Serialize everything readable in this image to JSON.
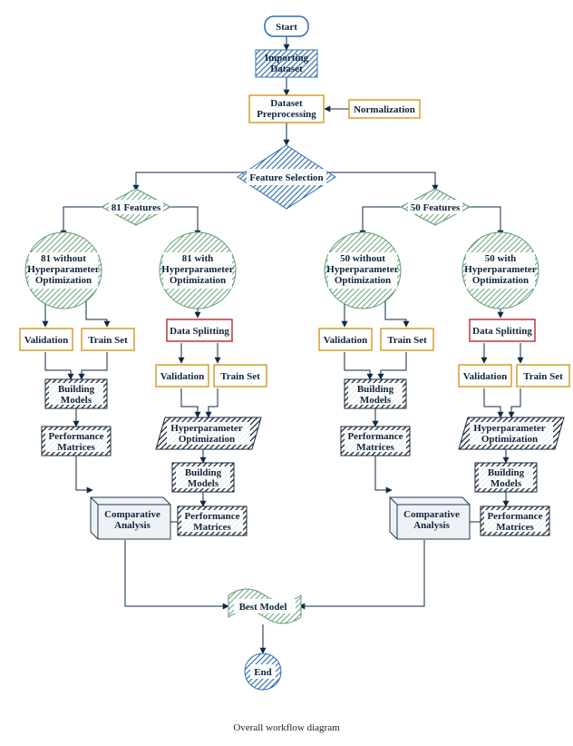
{
  "start": "Start",
  "import": "Importing\nDataset",
  "preproc": "Dataset\nPreprocessing",
  "norm": "Normalization",
  "feature": "Feature Selection",
  "f81": "81 Features",
  "f50": "50 Features",
  "c81no": "81 without\nHyperparameter\nOptimization",
  "c81yes": "81 with\nHyperparameter\nOptimization",
  "c50no": "50 without\nHyperparameter\nOptimization",
  "c50yes": "50 with\nHyperparameter\nOptimization",
  "validation": "Validation",
  "train": "Train Set",
  "split": "Data Splitting",
  "build": "Building\nModels",
  "hopt": "Hyperparameter\nOptimization",
  "perf": "Performance\nMatrices",
  "comp": "Comparative\nAnalysis",
  "best": "Best Model",
  "end": "End",
  "caption": "Overall workflow diagram"
}
